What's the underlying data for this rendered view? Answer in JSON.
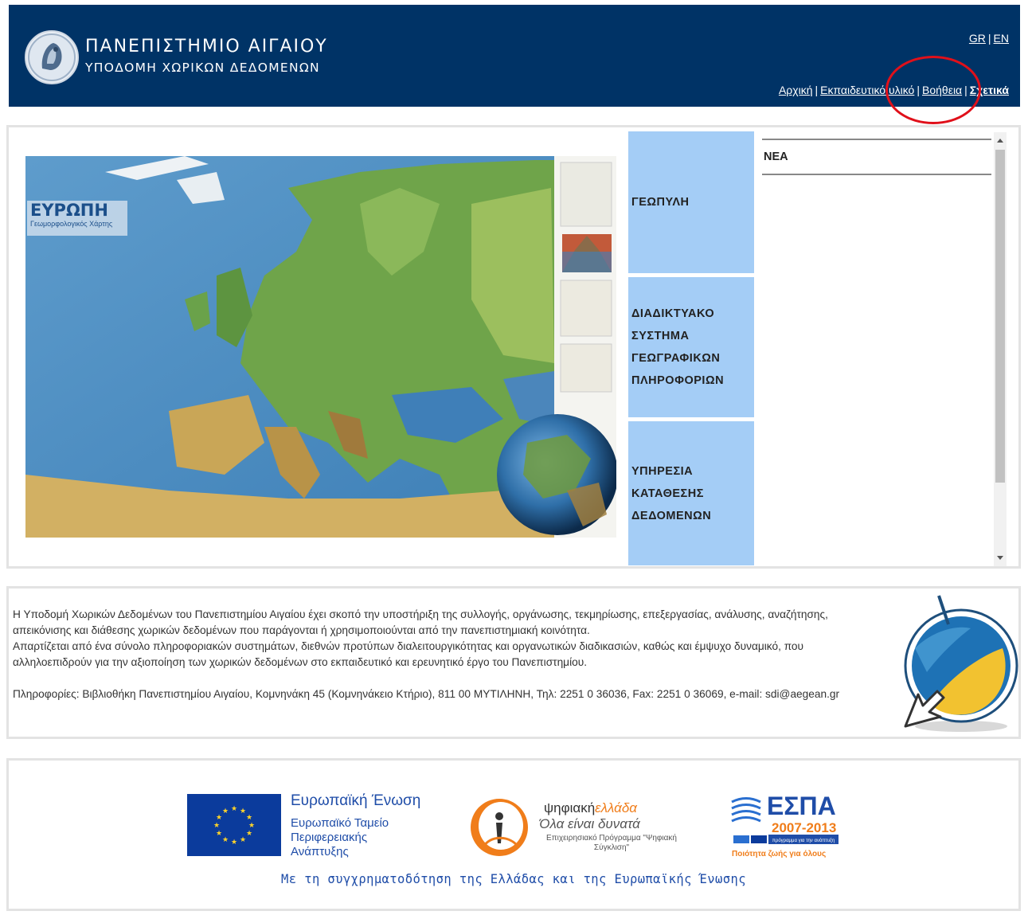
{
  "header": {
    "title": "ΠΑΝΕΠΙΣΤΗΜΙΟ ΑΙΓΑΙΟΥ",
    "subtitle": "ΥΠΟΔΟΜΗ ΧΩΡΙΚΩΝ ΔΕΔΟΜΕΝΩΝ",
    "lang": {
      "gr": "GR",
      "sep": "|",
      "en": "EN"
    },
    "nav": [
      {
        "label": "Αρχική"
      },
      {
        "label": "Εκπαιδευτικό υλικό"
      },
      {
        "label": "Βοήθεια"
      },
      {
        "label": "Σχετικά"
      }
    ],
    "nav_sep": "|",
    "colors": {
      "background": "#003366",
      "highlight": "#e0101a"
    }
  },
  "map": {
    "title": "ΕΥΡΩΠΗ",
    "subtitle": "Γεωμορφολογικός Χάρτης"
  },
  "menu": [
    {
      "label": "ΓΕΩΠΥΛΗ"
    },
    {
      "label": "ΔΙΑΔΙΚΤΥΑΚΟ ΣΥΣΤΗΜΑ ΓΕΩΓΡΑΦΙΚΩΝ ΠΛΗΡΟΦΟΡΙΩΝ"
    },
    {
      "label": "ΥΠΗΡΕΣΙΑ ΚΑΤΑΘΕΣΗΣ ΔΕΔΟΜΕΝΩΝ"
    }
  ],
  "menu_color": "#a4cdf6",
  "news": {
    "label": "ΝΕΑ"
  },
  "info": {
    "p1": "Η Υποδομή Χωρικών Δεδομένων του Πανεπιστημίου Αιγαίου έχει σκοπό την υποστήριξη της συλλογής, οργάνωσης, τεκμηρίωσης, επεξεργασίας, ανάλυσης, αναζήτησης, απεικόνισης και διάθεσης χωρικών δεδομένων που παράγονται ή χρησιμοποιούνται από την πανεπιστημιακή κοινότητα.",
    "p2": "Απαρτίζεται από ένα σύνολο πληροφοριακών συστημάτων, διεθνών προτύπων διαλειτουργικότητας και οργανωτικών διαδικασιών, καθώς και έμψυχο δυναμικό, που αλληλοεπιδρούν για την αξιοποίηση των χωρικών δεδομένων στο εκπαιδευτικό και ερευνητικό έργο του Πανεπιστημίου.",
    "p3": "Πληροφορίες: Βιβλιοθήκη Πανεπιστημίου Αιγαίου, Κομνηνάκη 45 (Κομνηνάκειο Κτήριο), 811 00 ΜΥΤΙΛΗΝΗ, Τηλ: 2251 0 36036, Fax: 2251 0 36069, e-mail: sdi@aegean.gr"
  },
  "footer": {
    "eu_title": "Ευρωπαϊκή Ένωση",
    "eu_fund": "Ευρωπαϊκό Ταμείο Περιφερειακής Ανάπτυξης",
    "dg_title_a": "ψηφιακή",
    "dg_title_b": "ελλάδα",
    "dg_slogan": "Όλα είναι δυνατά",
    "dg_sub": "Επιχειρησιακό Πρόγραμμα \"Ψηφιακή Σύγκλιση\"",
    "espa_title": "ΕΣΠΑ",
    "espa_years": "2007-2013",
    "espa_tag": "πρόγραμμα για την ανάπτυξη",
    "espa_slogan": "Ποιότητα ζωής για όλους",
    "cofund": "Με τη συγχρηματοδότηση της Ελλάδας και της Ευρωπαϊκής Ένωσης"
  }
}
